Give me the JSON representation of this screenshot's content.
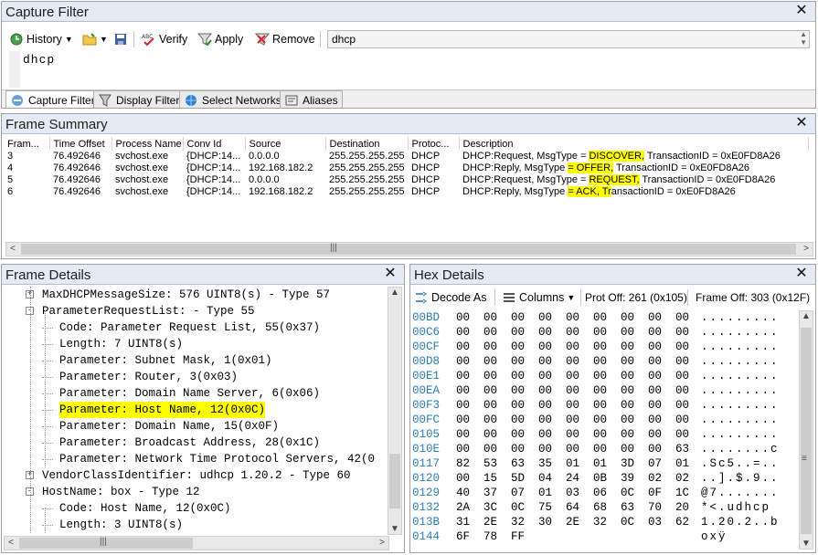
{
  "capture_filter": {
    "title": "Capture Filter",
    "toolbar": {
      "history_label": "History",
      "verify_label": "Verify",
      "apply_label": "Apply",
      "remove_label": "Remove",
      "filter_value": "dhcp"
    },
    "editor_text": "dhcp",
    "tabs": [
      "Capture Filter",
      "Display Filter",
      "Select Networks",
      "Aliases"
    ]
  },
  "frame_summary": {
    "title": "Frame Summary",
    "columns": [
      "Fram...",
      "Time Offset",
      "Process Name",
      "Conv Id",
      "Source",
      "Destination",
      "Protoc...",
      "Description"
    ],
    "rows": [
      {
        "frame": "3",
        "time": "76.492646",
        "process": "svchost.exe",
        "conv": "{DHCP:14...",
        "source": "0.0.0.0",
        "dest": "255.255.255.255",
        "proto": "DHCP",
        "desc_pre": "DHCP:Request, MsgType = ",
        "desc_hl": "DISCOVER,",
        "desc_post": " TransactionID = 0xE0FD8A26"
      },
      {
        "frame": "4",
        "time": "76.492646",
        "process": "svchost.exe",
        "conv": "{DHCP:14...",
        "source": "192.168.182.2",
        "dest": "255.255.255.255",
        "proto": "DHCP",
        "desc_pre": "DHCP:Reply, MsgType ",
        "desc_hl": "= OFFER,",
        "desc_post": " TransactionID = 0xE0FD8A26"
      },
      {
        "frame": "5",
        "time": "76.492646",
        "process": "svchost.exe",
        "conv": "{DHCP:14...",
        "source": "0.0.0.0",
        "dest": "255.255.255.255",
        "proto": "DHCP",
        "desc_pre": "DHCP:Request, MsgType = ",
        "desc_hl": "REQUEST,",
        "desc_post": " TransactionID = 0xE0FD8A26"
      },
      {
        "frame": "6",
        "time": "76.492646",
        "process": "svchost.exe",
        "conv": "{DHCP:14...",
        "source": "192.168.182.2",
        "dest": "255.255.255.255",
        "proto": "DHCP",
        "desc_pre": "DHCP:Reply, MsgType ",
        "desc_hl": "= ACK, Tr",
        "desc_post": "ansactionID = 0xE0FD8A26"
      }
    ]
  },
  "frame_details": {
    "title": "Frame Details",
    "lines": [
      {
        "text": "MaxDHCPMessageSize: 576 UINT8(s)  - Type 57",
        "expander": "+",
        "indent": 0
      },
      {
        "text": "ParameterRequestList:  - Type 55",
        "expander": "-",
        "indent": 0
      },
      {
        "text": "Code: Parameter Request List, 55(0x37)",
        "expander": "",
        "indent": 1
      },
      {
        "text": "Length: 7 UINT8(s)",
        "expander": "",
        "indent": 1
      },
      {
        "text": "Parameter: Subnet Mask, 1(0x01)",
        "expander": "",
        "indent": 1
      },
      {
        "text": "Parameter: Router, 3(0x03)",
        "expander": "",
        "indent": 1
      },
      {
        "text": "Parameter: Domain Name Server, 6(0x06)",
        "expander": "",
        "indent": 1
      },
      {
        "text": "Parameter: Host Name, 12(0x0C)",
        "expander": "",
        "indent": 1,
        "highlight": true
      },
      {
        "text": "Parameter: Domain Name, 15(0x0F)",
        "expander": "",
        "indent": 1
      },
      {
        "text": "Parameter: Broadcast Address, 28(0x1C)",
        "expander": "",
        "indent": 1
      },
      {
        "text": "Parameter: Network Time Protocol Servers, 42(0",
        "expander": "",
        "indent": 1
      },
      {
        "text": "VendorClassIdentifier: udhcp 1.20.2 - Type 60",
        "expander": "+",
        "indent": 0
      },
      {
        "text": "HostName: box - Type 12",
        "expander": "-",
        "indent": 0
      },
      {
        "text": "Code: Host Name, 12(0x0C)",
        "expander": "",
        "indent": 1
      },
      {
        "text": "Length: 3 UINT8(s)",
        "expander": "",
        "indent": 1
      }
    ]
  },
  "hex_details": {
    "title": "Hex Details",
    "toolbar": {
      "decode_as_label": "Decode As",
      "columns_label": "Columns",
      "prot_off": "Prot Off: 261 (0x105)",
      "frame_off": "Frame Off: 303 (0x12F)"
    },
    "rows": [
      {
        "offset": "00BD",
        "bytes": [
          "00",
          "00",
          "00",
          "00",
          "00",
          "00",
          "00",
          "00",
          "00"
        ],
        "ascii": "........."
      },
      {
        "offset": "00C6",
        "bytes": [
          "00",
          "00",
          "00",
          "00",
          "00",
          "00",
          "00",
          "00",
          "00"
        ],
        "ascii": "........."
      },
      {
        "offset": "00CF",
        "bytes": [
          "00",
          "00",
          "00",
          "00",
          "00",
          "00",
          "00",
          "00",
          "00"
        ],
        "ascii": "........."
      },
      {
        "offset": "00D8",
        "bytes": [
          "00",
          "00",
          "00",
          "00",
          "00",
          "00",
          "00",
          "00",
          "00"
        ],
        "ascii": "........."
      },
      {
        "offset": "00E1",
        "bytes": [
          "00",
          "00",
          "00",
          "00",
          "00",
          "00",
          "00",
          "00",
          "00"
        ],
        "ascii": "........."
      },
      {
        "offset": "00EA",
        "bytes": [
          "00",
          "00",
          "00",
          "00",
          "00",
          "00",
          "00",
          "00",
          "00"
        ],
        "ascii": "........."
      },
      {
        "offset": "00F3",
        "bytes": [
          "00",
          "00",
          "00",
          "00",
          "00",
          "00",
          "00",
          "00",
          "00"
        ],
        "ascii": "........."
      },
      {
        "offset": "00FC",
        "bytes": [
          "00",
          "00",
          "00",
          "00",
          "00",
          "00",
          "00",
          "00",
          "00"
        ],
        "ascii": "........."
      },
      {
        "offset": "0105",
        "bytes": [
          "00",
          "00",
          "00",
          "00",
          "00",
          "00",
          "00",
          "00",
          "00"
        ],
        "ascii": "........."
      },
      {
        "offset": "010E",
        "bytes": [
          "00",
          "00",
          "00",
          "00",
          "00",
          "00",
          "00",
          "00",
          "63"
        ],
        "ascii": "........c"
      },
      {
        "offset": "0117",
        "bytes": [
          "82",
          "53",
          "63",
          "35",
          "01",
          "01",
          "3D",
          "07",
          "01"
        ],
        "ascii": ".Sc5..=.."
      },
      {
        "offset": "0120",
        "bytes": [
          "00",
          "15",
          "5D",
          "04",
          "24",
          "0B",
          "39",
          "02",
          "02"
        ],
        "ascii": "..].$.9.."
      },
      {
        "offset": "0129",
        "bytes": [
          "40",
          "37",
          "07",
          "01",
          "03",
          "06",
          "0C",
          "0F",
          "1C"
        ],
        "ascii": "@7......."
      },
      {
        "offset": "0132",
        "bytes": [
          "2A",
          "3C",
          "0C",
          "75",
          "64",
          "68",
          "63",
          "70",
          "20"
        ],
        "ascii": "*<.udhcp "
      },
      {
        "offset": "013B",
        "bytes": [
          "31",
          "2E",
          "32",
          "30",
          "2E",
          "32",
          "0C",
          "03",
          "62"
        ],
        "ascii": "1.20.2..b"
      },
      {
        "offset": "0144",
        "bytes": [
          "6F",
          "78",
          "FF",
          "",
          "",
          "",
          "",
          "",
          ""
        ],
        "ascii": "oxÿ"
      }
    ]
  }
}
